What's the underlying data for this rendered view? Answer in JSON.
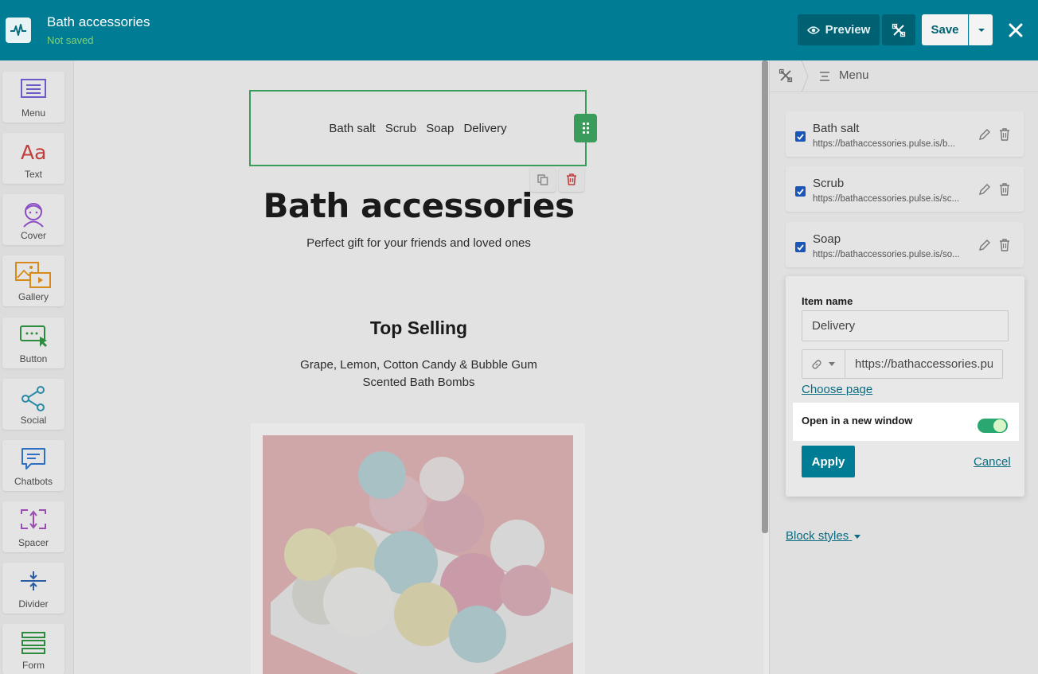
{
  "header": {
    "title": "Bath accessories",
    "status": "Not saved",
    "preview_label": "Preview",
    "save_label": "Save"
  },
  "tools": [
    {
      "label": "Menu",
      "icon": "menu-icon"
    },
    {
      "label": "Text",
      "icon": "text-icon"
    },
    {
      "label": "Cover",
      "icon": "cover-icon"
    },
    {
      "label": "Gallery",
      "icon": "gallery-icon"
    },
    {
      "label": "Button",
      "icon": "button-icon"
    },
    {
      "label": "Social",
      "icon": "social-icon"
    },
    {
      "label": "Chatbots",
      "icon": "chatbots-icon"
    },
    {
      "label": "Spacer",
      "icon": "spacer-icon"
    },
    {
      "label": "Divider",
      "icon": "divider-icon"
    },
    {
      "label": "Form",
      "icon": "form-icon"
    }
  ],
  "canvas": {
    "menu_items": [
      "Bath salt",
      "Scrub",
      "Soap",
      "Delivery"
    ],
    "title": "Bath accessories",
    "subtitle": "Perfect gift for your friends and loved ones",
    "section_title": "Top Selling",
    "section_line1": "Grape, Lemon, Cotton Candy & Bubble Gum",
    "section_line2": "Scented Bath Bombs"
  },
  "panel": {
    "crumb": "Menu",
    "items": [
      {
        "name": "Bath salt",
        "url": "https://bathaccessories.pulse.is/b..."
      },
      {
        "name": "Scrub",
        "url": "https://bathaccessories.pulse.is/sc..."
      },
      {
        "name": "Soap",
        "url": "https://bathaccessories.pulse.is/so..."
      }
    ],
    "block_styles": "Block styles"
  },
  "popup": {
    "item_name_label": "Item name",
    "item_name_value": "Delivery",
    "url_value": "https://bathaccessories.pulse.is/",
    "choose_page": "Choose page",
    "new_window_label": "Open in a new window",
    "new_window_on": true,
    "apply_label": "Apply",
    "cancel_label": "Cancel"
  },
  "colors": {
    "brand": "#007c94",
    "accent_green": "#3a9c5b",
    "toggle_on": "#2aa872"
  }
}
